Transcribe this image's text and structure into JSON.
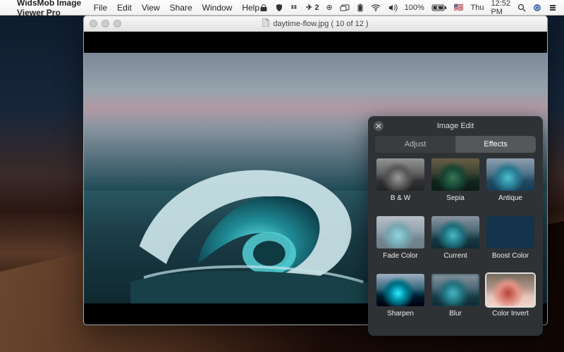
{
  "menubar": {
    "app_name": "WidsMob Image Viewer Pro",
    "items": [
      "File",
      "Edit",
      "View",
      "Share",
      "Window",
      "Help"
    ],
    "right": {
      "icon2_label": "2",
      "battery": "100%",
      "flag": "🇺🇸",
      "day": "Thu",
      "time": "12:52 PM"
    }
  },
  "window": {
    "title": "daytime-flow.jpg ( 10 of 12 )"
  },
  "panel": {
    "title": "Image Edit",
    "tabs": {
      "adjust": "Adjust",
      "effects": "Effects"
    },
    "effects": [
      "B & W",
      "Sepia",
      "Antique",
      "Fade Color",
      "Current",
      "Boost Color",
      "Sharpen",
      "Blur",
      "Color Invert"
    ]
  }
}
